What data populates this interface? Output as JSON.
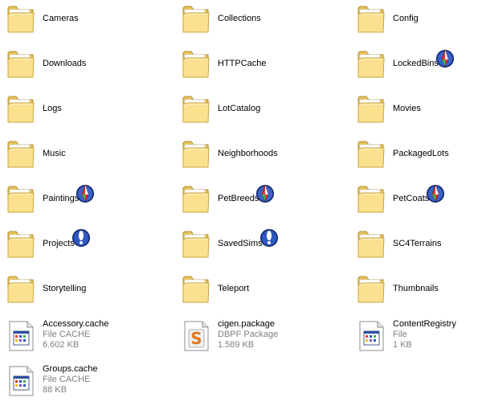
{
  "folders": [
    {
      "name": "Cameras",
      "badge": null
    },
    {
      "name": "Collections",
      "badge": null
    },
    {
      "name": "Config",
      "badge": null
    },
    {
      "name": "Downloads",
      "badge": null
    },
    {
      "name": "HTTPCache",
      "badge": null
    },
    {
      "name": "LockedBins",
      "badge": "plumbob"
    },
    {
      "name": "Logs",
      "badge": null
    },
    {
      "name": "LotCatalog",
      "badge": null
    },
    {
      "name": "Movies",
      "badge": null
    },
    {
      "name": "Music",
      "badge": null
    },
    {
      "name": "Neighborhoods",
      "badge": null
    },
    {
      "name": "PackagedLots",
      "badge": null
    },
    {
      "name": "Paintings",
      "badge": "plumbob"
    },
    {
      "name": "PetBreeds",
      "badge": "plumbob"
    },
    {
      "name": "PetCoats",
      "badge": "plumbob"
    },
    {
      "name": "Projects",
      "badge": "exclaim"
    },
    {
      "name": "SavedSims",
      "badge": "exclaim"
    },
    {
      "name": "SC4Terrains",
      "badge": null
    },
    {
      "name": "Storytelling",
      "badge": null
    },
    {
      "name": "Teleport",
      "badge": null
    },
    {
      "name": "Thumbnails",
      "badge": null
    }
  ],
  "files": [
    {
      "name": "Accessory.cache",
      "type": "File CACHE",
      "size": "6.602 KB",
      "icon": "cache"
    },
    {
      "name": "cigen.package",
      "type": "DBPF Package",
      "size": "1.589 KB",
      "icon": "package"
    },
    {
      "name": "ContentRegistry",
      "type": "File",
      "size": "1 KB",
      "icon": "cache"
    },
    {
      "name": "Groups.cache",
      "type": "File CACHE",
      "size": "88 KB",
      "icon": "cache"
    }
  ],
  "colors": {
    "folder_body": "#f7d774",
    "folder_front": "#fde79b",
    "folder_edge": "#c8a33c",
    "secondary_text": "#808080"
  }
}
